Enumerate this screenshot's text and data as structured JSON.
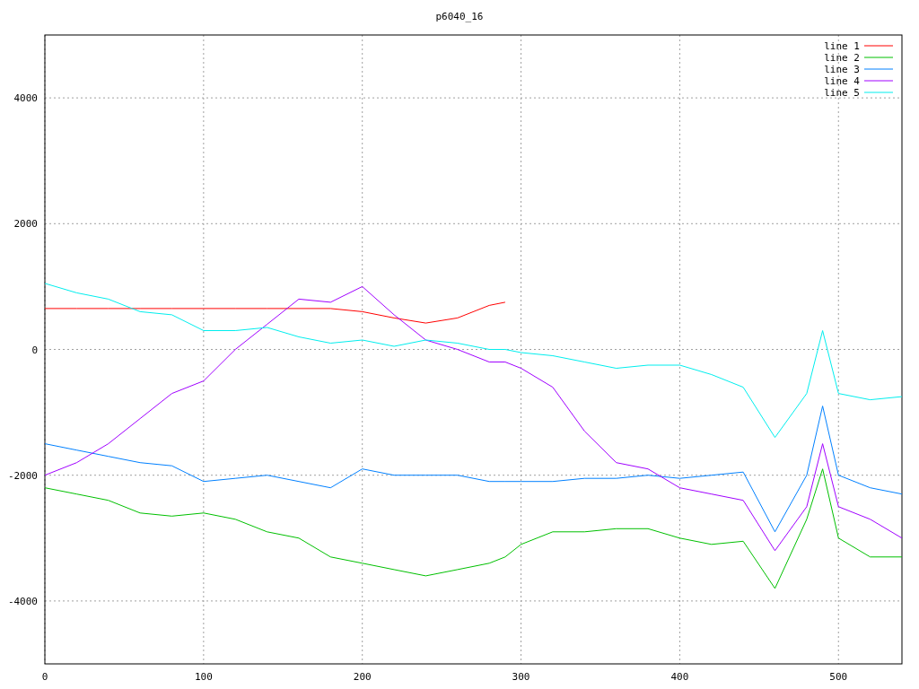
{
  "chart": {
    "chart_data": {
      "type": "line",
      "title": "p6040_16",
      "x": [
        0,
        20,
        40,
        60,
        80,
        100,
        120,
        140,
        160,
        180,
        200,
        220,
        240,
        260,
        280,
        290,
        300,
        320,
        340,
        360,
        380,
        400,
        420,
        440,
        460,
        480,
        490,
        500,
        520,
        540
      ],
      "xlim": [
        0,
        540
      ],
      "ylim": [
        -5000,
        5000
      ],
      "xticks": [
        0,
        100,
        200,
        300,
        400,
        500
      ],
      "grid": true,
      "legend": true,
      "yticks": [
        -4000,
        -2000,
        0,
        2000,
        4000
      ],
      "series": [
        {
          "name": "line 1",
          "color": "#ff0000",
          "values": [
            650,
            650,
            650,
            650,
            650,
            650,
            650,
            650,
            650,
            650,
            600,
            500,
            420,
            500,
            700,
            750,
            null,
            null,
            null,
            null,
            null,
            null,
            null,
            null,
            null,
            null,
            null,
            null,
            null,
            null
          ]
        },
        {
          "name": "line 2",
          "color": "#00c000",
          "values": [
            -2200,
            -2300,
            -2400,
            -2600,
            -2650,
            -2600,
            -2700,
            -2900,
            -3000,
            -3300,
            -3400,
            -3500,
            -3600,
            -3500,
            -3400,
            -3300,
            -3100,
            -2900,
            -2900,
            -2850,
            -2850,
            -3000,
            -3100,
            -3050,
            -3800,
            -2700,
            -1900,
            -3000,
            -3300,
            -3300
          ]
        },
        {
          "name": "line 3",
          "color": "#0080ff",
          "values": [
            -1500,
            -1600,
            -1700,
            -1800,
            -1850,
            -2100,
            -2050,
            -2000,
            -2100,
            -2200,
            -1900,
            -2000,
            -2000,
            -2000,
            -2100,
            -2100,
            -2100,
            -2100,
            -2050,
            -2050,
            -2000,
            -2050,
            -2000,
            -1950,
            -2900,
            -2000,
            -900,
            -2000,
            -2200,
            -2300
          ]
        },
        {
          "name": "line 4",
          "color": "#a000ff",
          "values": [
            -2000,
            -1800,
            -1500,
            -1100,
            -700,
            -500,
            0,
            400,
            800,
            750,
            1000,
            550,
            150,
            0,
            -200,
            -200,
            -300,
            -600,
            -1300,
            -1800,
            -1900,
            -2200,
            -2300,
            -2400,
            -3200,
            -2500,
            -1500,
            -2500,
            -2700,
            -3000
          ]
        },
        {
          "name": "line 5",
          "color": "#00eeee",
          "values": [
            1050,
            900,
            800,
            600,
            550,
            300,
            300,
            350,
            200,
            100,
            150,
            50,
            150,
            100,
            0,
            0,
            -50,
            -100,
            -200,
            -300,
            -250,
            -250,
            -400,
            -600,
            -1400,
            -700,
            300,
            -700,
            -800,
            -750
          ]
        }
      ]
    }
  }
}
